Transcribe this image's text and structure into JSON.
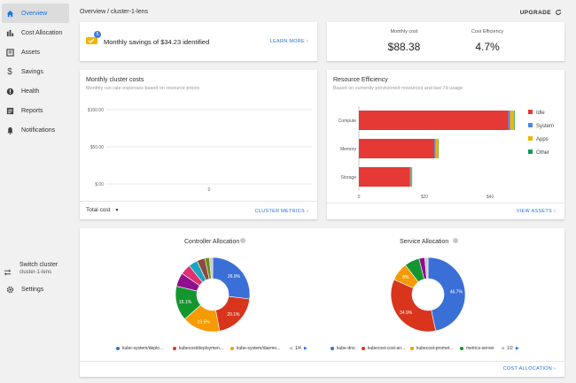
{
  "sidebar": {
    "items": [
      {
        "label": "Overview",
        "icon": "home-icon",
        "active": true
      },
      {
        "label": "Cost Allocation",
        "icon": "bar-chart-icon"
      },
      {
        "label": "Assets",
        "icon": "list-box-icon"
      },
      {
        "label": "Savings",
        "icon": "dollar-icon"
      },
      {
        "label": "Health",
        "icon": "alert-circle-icon"
      },
      {
        "label": "Reports",
        "icon": "report-icon"
      },
      {
        "label": "Notifications",
        "icon": "bell-icon"
      }
    ],
    "switch_cluster": {
      "label": "Switch cluster",
      "cluster": "cluster-1-lens",
      "icon": "swap-icon"
    },
    "settings": {
      "label": "Settings",
      "icon": "gear-icon"
    }
  },
  "header": {
    "breadcrumb": "Overview / cluster-1-lens",
    "upgrade": "UPGRADE"
  },
  "savings_card": {
    "text": "Monthly savings of $34.23 identified",
    "badge": "5",
    "link": "LEARN MORE"
  },
  "cost_card": {
    "monthly_cost_label": "Monthly cost",
    "monthly_cost_value": "$88.38",
    "efficiency_label": "Cost Efficiency",
    "efficiency_value": "4.7%"
  },
  "cluster_costs_card": {
    "title": "Monthly cluster costs",
    "subtitle": "Monthly run rate expenses based on resource prices",
    "dropdown": "Total cost",
    "link": "CLUSTER METRICS",
    "chart_data": {
      "type": "line",
      "y_ticks": [
        "$100.00",
        "$50.00",
        "$.00"
      ],
      "x_ticks": [
        "0"
      ],
      "ylim": [
        0,
        100
      ],
      "series": []
    }
  },
  "resource_card": {
    "title": "Resource Efficiency",
    "subtitle": "Based on currently provisioned resources and last 7d usage",
    "link": "VIEW ASSETS",
    "chart_data": {
      "type": "bar",
      "orientation": "horizontal",
      "categories": [
        "Compute",
        "Memory",
        "Storage"
      ],
      "x_ticks": [
        "0",
        "$20",
        "$40"
      ],
      "xlim": [
        0,
        47
      ],
      "series": [
        {
          "name": "Idle",
          "color": "#e53935",
          "values": [
            45.5,
            23.0,
            15.5
          ]
        },
        {
          "name": "System",
          "color": "#4a86e8",
          "values": [
            0.6,
            0.4,
            0.3
          ]
        },
        {
          "name": "Apps",
          "color": "#f4b400",
          "values": [
            1.2,
            0.8,
            0.3
          ]
        },
        {
          "name": "Other",
          "color": "#0f9d58",
          "values": [
            0.2,
            0.1,
            0.1
          ]
        }
      ]
    }
  },
  "allocation_card": {
    "link": "COST ALLOCATION",
    "controller": {
      "title": "Controller Allocation",
      "pager": "1/4",
      "chart_data": {
        "type": "pie",
        "labels": [
          "kube-system/deployment",
          "kubecost/deployment",
          "kube-system/daemonset",
          "",
          "",
          "",
          "",
          "",
          "",
          ""
        ],
        "values": [
          26.9,
          20.1,
          16.5,
          15.1,
          6.0,
          4.5,
          4.0,
          3.5,
          2.0,
          1.4
        ],
        "colors": [
          "#3b6fd8",
          "#d8351c",
          "#f59a00",
          "#13962e",
          "#8f0f8c",
          "#e0306f",
          "#1aa5c0",
          "#8b4a3f",
          "#6a8d1e",
          "#c8c8c8"
        ],
        "data_labels": [
          "26.9%",
          "20.1%",
          "16.5%",
          "15.1%",
          "",
          "",
          "",
          "",
          "",
          ""
        ]
      },
      "legend": [
        "kube-system/deplo...",
        "kubecost/deploymen...",
        "kube-system/daemo..."
      ]
    },
    "service": {
      "title": "Service Allocation",
      "pager": "1/2",
      "chart_data": {
        "type": "pie",
        "labels": [
          "kube-dns",
          "kubecost-cost-analyzer",
          "kubecost-prometheus",
          "metrics-server",
          "",
          ""
        ],
        "values": [
          46.7,
          34.9,
          8.0,
          6.5,
          2.5,
          1.4
        ],
        "colors": [
          "#3b6fd8",
          "#d8351c",
          "#f59a00",
          "#13962e",
          "#8f0f8c",
          "#c8c8c8"
        ],
        "data_labels": [
          "46.7%",
          "34.9%",
          "8%",
          "",
          "",
          ""
        ]
      },
      "legend": [
        "kube-dns",
        "kubecost-cost-an...",
        "kubecost-promet...",
        "metrics-server"
      ]
    }
  }
}
